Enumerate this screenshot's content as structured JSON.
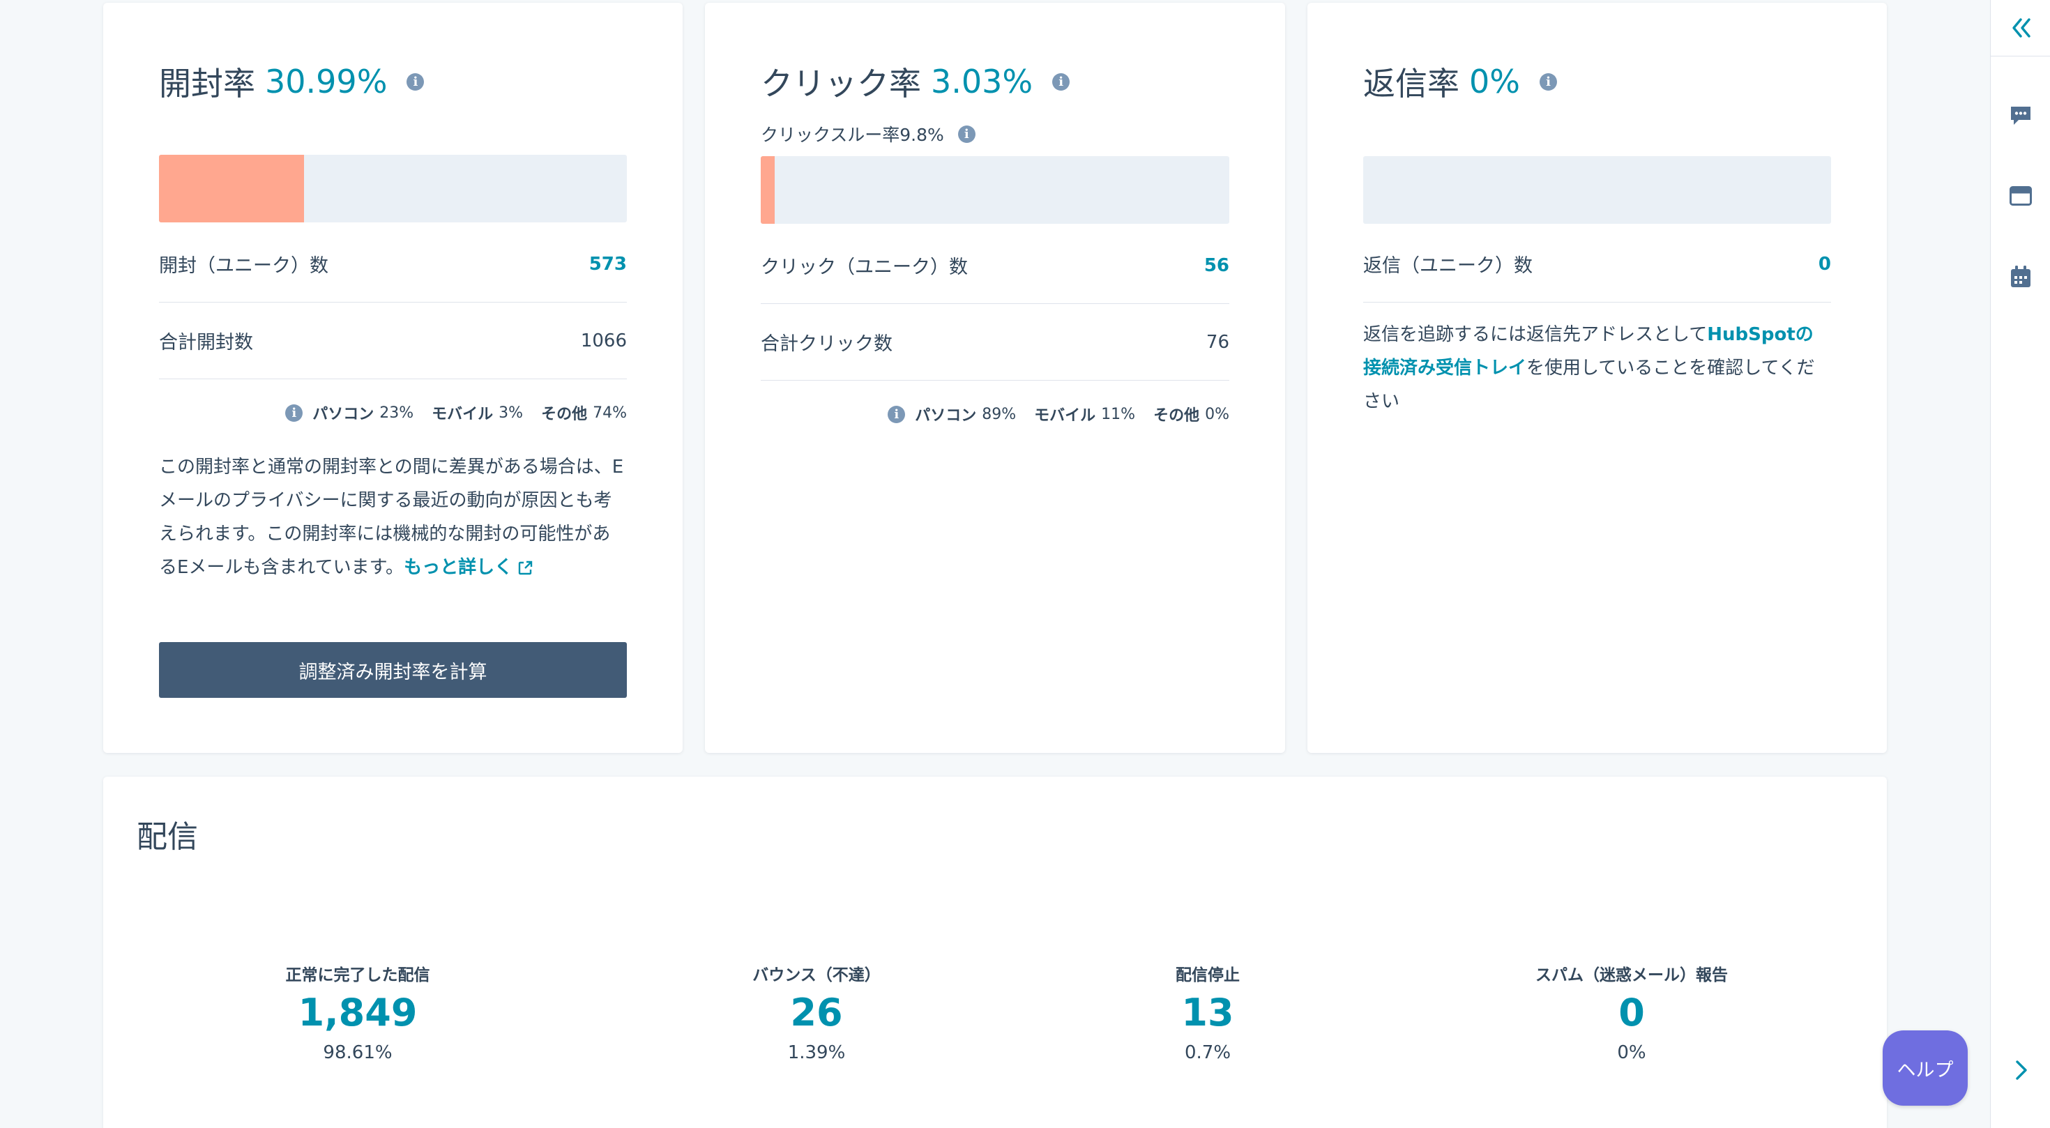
{
  "open_card": {
    "title": "開封率",
    "rate": "30.99%",
    "bar_fill_percent": 30.99,
    "unique_label": "開封（ユニーク）数",
    "unique_value": "573",
    "total_label": "合計開封数",
    "total_value": "1066",
    "devices": [
      {
        "label": "パソコン",
        "value": "23%"
      },
      {
        "label": "モバイル",
        "value": "3%"
      },
      {
        "label": "その他",
        "value": "74%"
      }
    ],
    "note_text": "この開封率と通常の開封率との間に差異がある場合は、Eメールのプライバシーに関する最近の動向が原因とも考えられます。この開封率には機械的な開封の可能性があるEメールも含まれています。",
    "note_link": "もっと詳しく",
    "button_label": "調整済み開封率を計算"
  },
  "click_card": {
    "title": "クリック率",
    "rate": "3.03%",
    "subtitle": "クリックスルー率9.8%",
    "bar_fill_percent": 3.03,
    "unique_label": "クリック（ユニーク）数",
    "unique_value": "56",
    "total_label": "合計クリック数",
    "total_value": "76",
    "devices": [
      {
        "label": "パソコン",
        "value": "89%"
      },
      {
        "label": "モバイル",
        "value": "11%"
      },
      {
        "label": "その他",
        "value": "0%"
      }
    ]
  },
  "reply_card": {
    "title": "返信率",
    "rate": "0%",
    "bar_fill_percent": 0,
    "unique_label": "返信（ユニーク）数",
    "unique_value": "0",
    "note_before": "返信を追跡するには返信先アドレスとして",
    "note_link": "HubSpotの接続済み受信トレイ",
    "note_after": "を使用していることを確認してください"
  },
  "delivery": {
    "title": "配信",
    "stats": [
      {
        "label": "正常に完了した配信",
        "value": "1,849",
        "pct": "98.61%"
      },
      {
        "label": "バウンス（不達）",
        "value": "26",
        "pct": "1.39%"
      },
      {
        "label": "配信停止",
        "value": "13",
        "pct": "0.7%"
      },
      {
        "label": "スパム（迷惑メール）報告",
        "value": "0",
        "pct": "0%"
      }
    ]
  },
  "help_button": "ヘルプ",
  "info_glyph": "i",
  "rail_icons": [
    "double-chevron-left-icon",
    "chat-icon",
    "inbox-icon",
    "calendar-icon",
    "chevron-right-icon"
  ],
  "colors": {
    "accent": "#0091ae",
    "bar_fill": "#ffa78f",
    "bar_track": "#eaf0f6",
    "primary_button": "#425b76",
    "help_button": "#6f6ee0"
  }
}
